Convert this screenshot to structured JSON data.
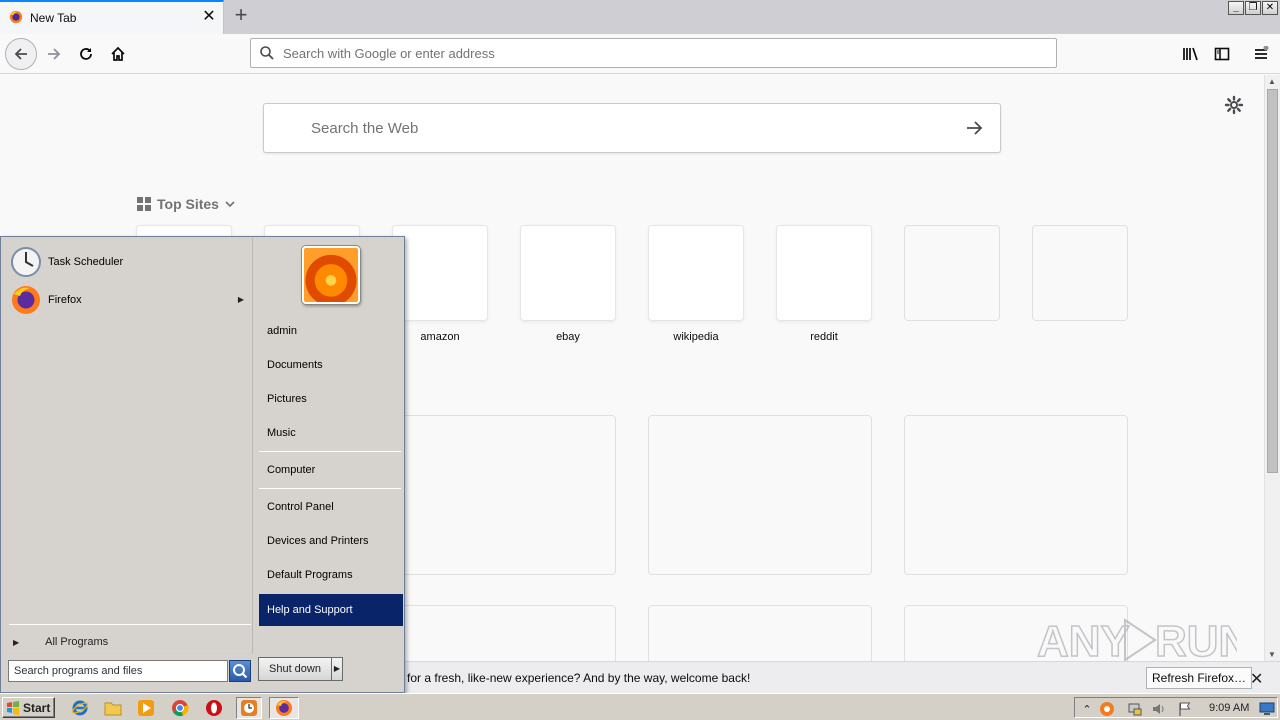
{
  "browser": {
    "tab": {
      "title": "New Tab",
      "close_glyph": "✕"
    },
    "new_tab_glyph": "+",
    "window_controls": {
      "minimize": "_",
      "restore": "❐",
      "close": "✕"
    },
    "urlbar": {
      "placeholder": "Search with Google or enter address"
    },
    "accent": "#0a84ff"
  },
  "newtab": {
    "web_search": {
      "placeholder": "Search the Web"
    },
    "top_sites": {
      "heading": "Top Sites",
      "tiles": [
        {
          "label": ""
        },
        {
          "label": ""
        },
        {
          "label": "amazon"
        },
        {
          "label": "ebay"
        },
        {
          "label": "wikipedia"
        },
        {
          "label": "reddit"
        },
        {
          "label": ""
        },
        {
          "label": ""
        }
      ]
    }
  },
  "notification": {
    "message": "p for a fresh, like-new experience? And by the way, welcome back!",
    "button": "Refresh Firefox…",
    "close_glyph": "✕"
  },
  "watermark": {
    "text": "ANY RUN"
  },
  "start_menu": {
    "programs": [
      {
        "label": "Task Scheduler",
        "icon": "clock-icon"
      },
      {
        "label": "Firefox",
        "icon": "firefox-icon",
        "has_submenu": true
      }
    ],
    "all_programs": "All Programs",
    "search_placeholder": "Search programs and files",
    "right_links": {
      "user": "admin",
      "documents": "Documents",
      "pictures": "Pictures",
      "music": "Music",
      "computer": "Computer",
      "control_panel": "Control Panel",
      "devices": "Devices and Printers",
      "default_programs": "Default Programs",
      "help": "Help and Support"
    },
    "shutdown": "Shut down"
  },
  "taskbar": {
    "start_label": "Start",
    "clock": "9:09 AM"
  }
}
